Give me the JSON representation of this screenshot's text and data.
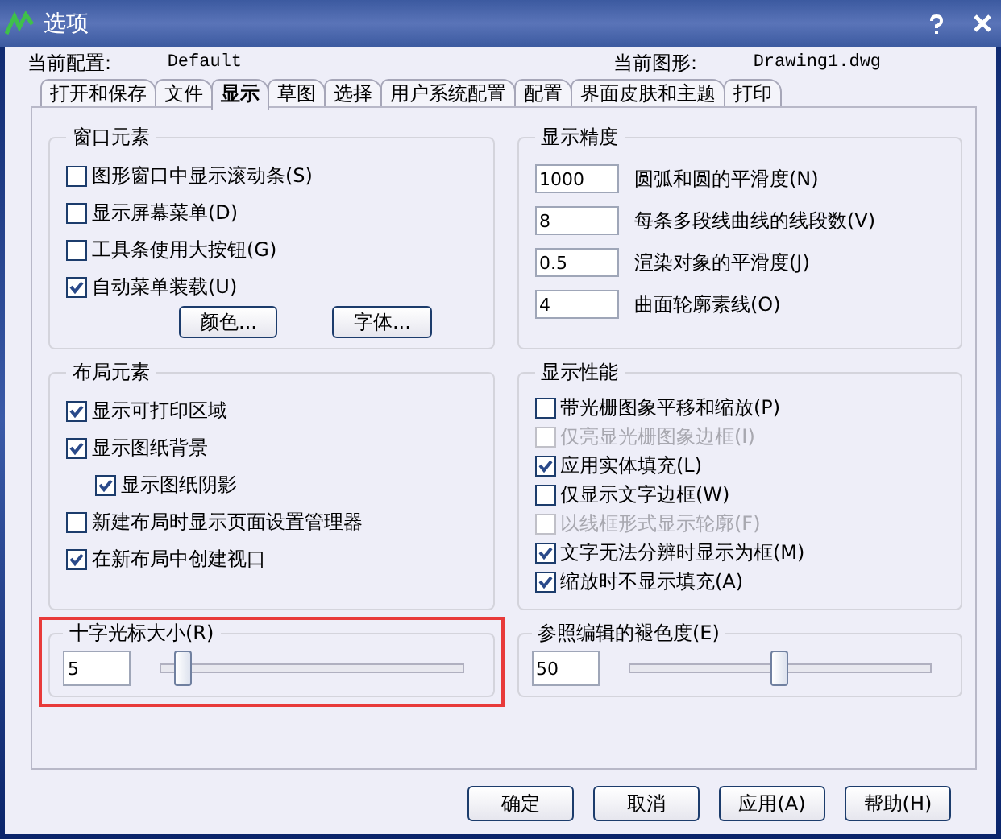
{
  "window": {
    "title": "选项"
  },
  "header": {
    "profile_label": "当前配置:",
    "profile": "Default",
    "drawing_label": "当前图形:",
    "drawing": "Drawing1.dwg"
  },
  "tabs": [
    {
      "label": "打开和保存",
      "selected": false
    },
    {
      "label": "文件",
      "selected": false
    },
    {
      "label": "显示",
      "selected": true
    },
    {
      "label": "草图",
      "selected": false
    },
    {
      "label": "选择",
      "selected": false
    },
    {
      "label": "用户系统配置",
      "selected": false
    },
    {
      "label": "配置",
      "selected": false
    },
    {
      "label": "界面皮肤和主题",
      "selected": false
    },
    {
      "label": "打印",
      "selected": false
    }
  ],
  "window_elements": {
    "title": "窗口元素",
    "options": [
      {
        "label": "图形窗口中显示滚动条(S)",
        "checked": false
      },
      {
        "label": "显示屏幕菜单(D)",
        "checked": false
      },
      {
        "label": "工具条使用大按钮(G)",
        "checked": false
      },
      {
        "label": "自动菜单装载(U)",
        "checked": true
      }
    ],
    "buttons": [
      "颜色...",
      "字体..."
    ]
  },
  "display_resolution": {
    "title": "显示精度",
    "fields": [
      {
        "value": "1000",
        "label": "圆弧和圆的平滑度(N)"
      },
      {
        "value": "8",
        "label": "每条多段线曲线的线段数(V)"
      },
      {
        "value": "0.5",
        "label": "渲染对象的平滑度(J)"
      },
      {
        "value": "4",
        "label": "曲面轮廓素线(O)"
      }
    ]
  },
  "layout_elements": {
    "title": "布局元素",
    "options": [
      {
        "label": "显示可打印区域",
        "checked": true
      },
      {
        "label": "显示图纸背景",
        "checked": true,
        "children": [
          {
            "label": "显示图纸阴影",
            "checked": true
          }
        ]
      },
      {
        "label": "新建布局时显示页面设置管理器",
        "checked": false
      },
      {
        "label": "在新布局中创建视口",
        "checked": true
      }
    ]
  },
  "display_performance": {
    "title": "显示性能",
    "options": [
      {
        "label": "带光栅图象平移和缩放(P)",
        "checked": false,
        "disabled": false
      },
      {
        "label": "仅亮显光栅图象边框(I)",
        "checked": false,
        "disabled": true
      },
      {
        "label": "应用实体填充(L)",
        "checked": true,
        "disabled": false
      },
      {
        "label": "仅显示文字边框(W)",
        "checked": false,
        "disabled": false
      },
      {
        "label": "以线框形式显示轮廓(F)",
        "checked": false,
        "disabled": true
      },
      {
        "label": "文字无法分辨时显示为框(M)",
        "checked": true,
        "disabled": false
      },
      {
        "label": "缩放时不显示填充(A)",
        "checked": true,
        "disabled": false
      }
    ]
  },
  "crosshair_size": {
    "title": "十字光标大小(R)",
    "value": "5",
    "level": 0.05,
    "highlighted": true
  },
  "xref_fading": {
    "title": "参照编辑的褪色度(E)",
    "value": "50",
    "level": 0.5,
    "highlighted": false
  },
  "buttons": [
    "确定",
    "取消",
    "应用(A)",
    "帮助(H)"
  ]
}
